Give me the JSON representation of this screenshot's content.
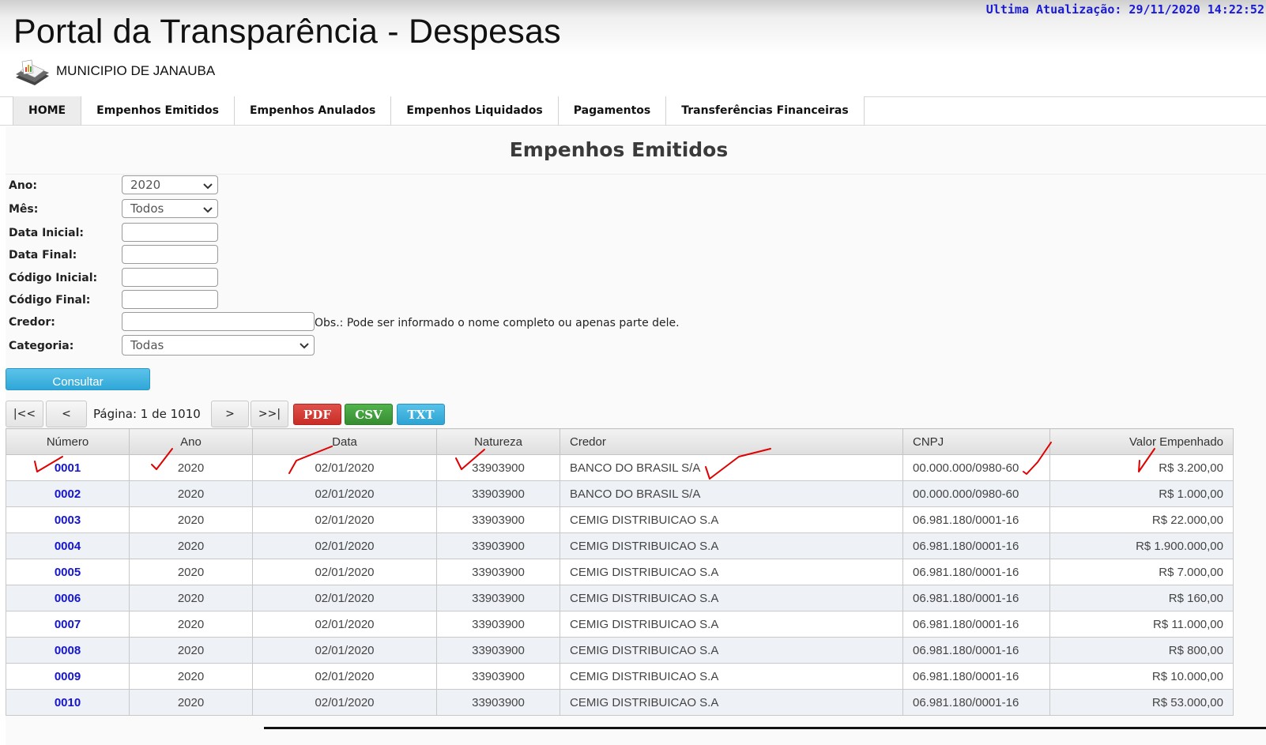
{
  "header": {
    "last_update": "Ultima Atualização: 29/11/2020 14:22:52",
    "title": "Portal da Transparência - Despesas",
    "org": "MUNICIPIO DE JANAUBA"
  },
  "nav": [
    {
      "label": "HOME"
    },
    {
      "label": "Empenhos Emitidos"
    },
    {
      "label": "Empenhos Anulados"
    },
    {
      "label": "Empenhos Liquidados"
    },
    {
      "label": "Pagamentos"
    },
    {
      "label": "Transferências Financeiras"
    }
  ],
  "page_title": "Empenhos Emitidos",
  "form": {
    "ano_label": "Ano:",
    "ano_value": "2020",
    "mes_label": "Mês:",
    "mes_value": "Todos",
    "data_inicial_label": "Data Inicial:",
    "data_final_label": "Data Final:",
    "codigo_inicial_label": "Código Inicial:",
    "codigo_final_label": "Código Final:",
    "credor_label": "Credor:",
    "credor_obs": "Obs.: Pode ser informado o nome completo ou apenas parte dele.",
    "categoria_label": "Categoria:",
    "categoria_value": "Todas",
    "submit_label": "Consultar"
  },
  "pagination": {
    "first": "|<<",
    "prev": "<",
    "next": ">",
    "last": ">>|",
    "info": "Página: 1 de 1010",
    "pdf": "PDF",
    "csv": "CSV",
    "txt": "TXT"
  },
  "table": {
    "headers": [
      "Número",
      "Ano",
      "Data",
      "Natureza",
      "Credor",
      "CNPJ",
      "Valor Empenhado"
    ],
    "rows": [
      [
        "0001",
        "2020",
        "02/01/2020",
        "33903900",
        "BANCO DO BRASIL S/A",
        "00.000.000/0980-60",
        "R$ 3.200,00"
      ],
      [
        "0002",
        "2020",
        "02/01/2020",
        "33903900",
        "BANCO DO BRASIL S/A",
        "00.000.000/0980-60",
        "R$ 1.000,00"
      ],
      [
        "0003",
        "2020",
        "02/01/2020",
        "33903900",
        "CEMIG DISTRIBUICAO S.A",
        "06.981.180/0001-16",
        "R$ 22.000,00"
      ],
      [
        "0004",
        "2020",
        "02/01/2020",
        "33903900",
        "CEMIG DISTRIBUICAO S.A",
        "06.981.180/0001-16",
        "R$ 1.900.000,00"
      ],
      [
        "0005",
        "2020",
        "02/01/2020",
        "33903900",
        "CEMIG DISTRIBUICAO S.A",
        "06.981.180/0001-16",
        "R$ 7.000,00"
      ],
      [
        "0006",
        "2020",
        "02/01/2020",
        "33903900",
        "CEMIG DISTRIBUICAO S.A",
        "06.981.180/0001-16",
        "R$ 160,00"
      ],
      [
        "0007",
        "2020",
        "02/01/2020",
        "33903900",
        "CEMIG DISTRIBUICAO S.A",
        "06.981.180/0001-16",
        "R$ 11.000,00"
      ],
      [
        "0008",
        "2020",
        "02/01/2020",
        "33903900",
        "CEMIG DISTRIBUICAO S.A",
        "06.981.180/0001-16",
        "R$ 800,00"
      ],
      [
        "0009",
        "2020",
        "02/01/2020",
        "33903900",
        "CEMIG DISTRIBUICAO S.A",
        "06.981.180/0001-16",
        "R$ 10.000,00"
      ],
      [
        "0010",
        "2020",
        "02/01/2020",
        "33903900",
        "CEMIG DISTRIBUICAO S.A",
        "06.981.180/0001-16",
        "R$ 53.000,00"
      ]
    ]
  },
  "colors": {
    "accent_blue": "#1515cc",
    "consultar": "#2fa7d8",
    "pdf": "#d23a33",
    "csv": "#3f9f3a",
    "txt": "#3ab0dc",
    "annotation": "#e00000"
  }
}
